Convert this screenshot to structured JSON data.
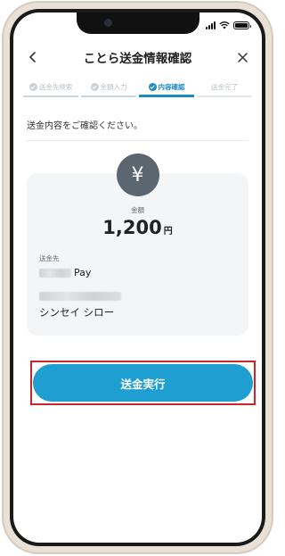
{
  "header": {
    "title": "ことら送金情報確認"
  },
  "steps": [
    {
      "label": "送金先検索",
      "state": "done"
    },
    {
      "label": "金額入力",
      "state": "done"
    },
    {
      "label": "内容確認",
      "state": "active"
    },
    {
      "label": "送金完了",
      "state": "todo"
    }
  ],
  "instruction": "送金内容をご確認ください。",
  "summary": {
    "icon": "yen-icon",
    "amount_label": "金額",
    "amount": "1,200",
    "currency": "円",
    "recipient_label": "送金先",
    "recipient_bank_suffix": "Pay",
    "recipient_name": "シンセイ シロー"
  },
  "submit_label": "送金実行",
  "colors": {
    "accent": "#1f9fd1",
    "highlight": "#c9262c",
    "icon_bg": "#5b6670"
  }
}
